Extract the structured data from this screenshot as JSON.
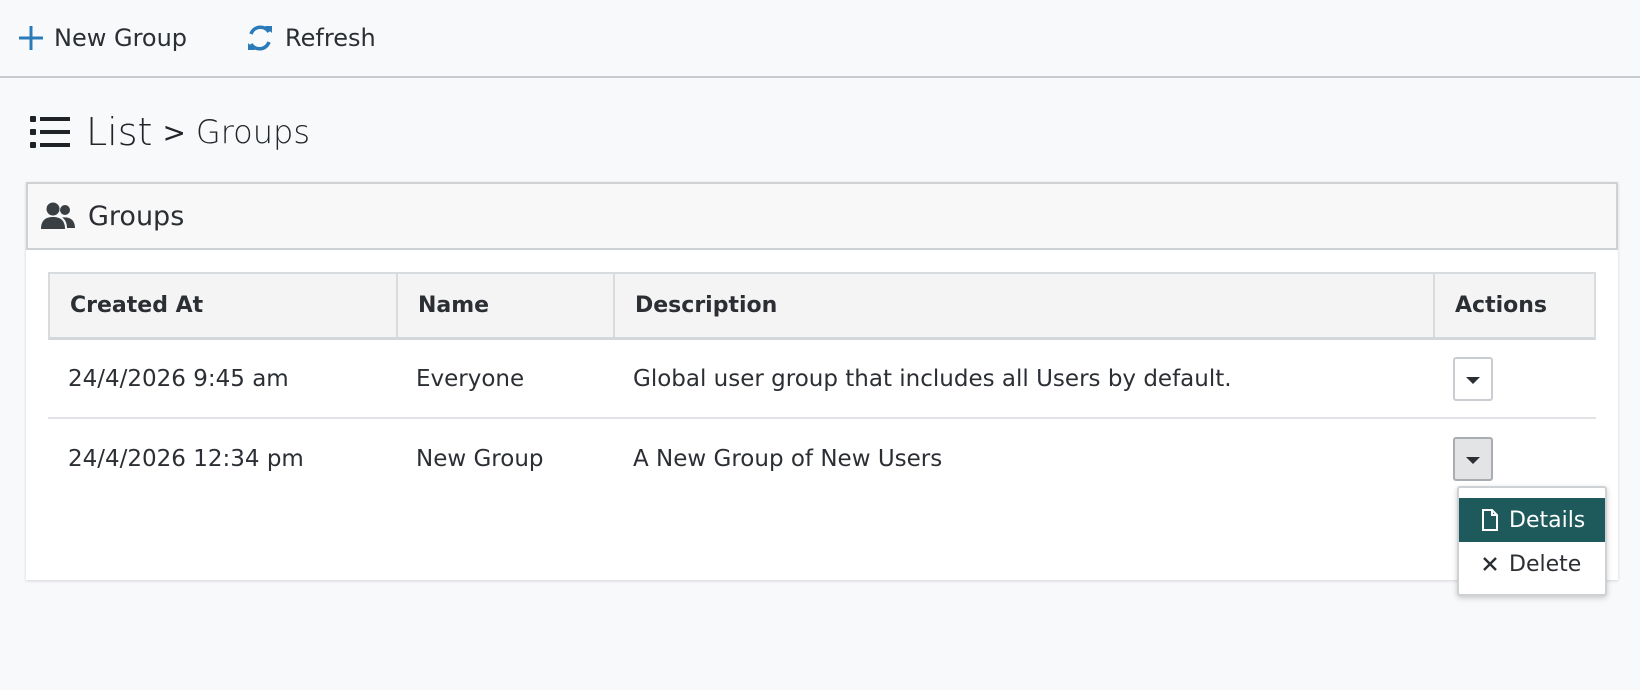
{
  "toolbar": {
    "new_group_label": "New Group",
    "refresh_label": "Refresh"
  },
  "page": {
    "title": "List",
    "separator": ">",
    "subtitle": "Groups"
  },
  "card": {
    "title": "Groups"
  },
  "table": {
    "headers": [
      "Created At",
      "Name",
      "Description",
      "Actions"
    ],
    "rows": [
      {
        "created_at": "24/4/2026 9:45 am",
        "name": "Everyone",
        "description": "Global user group that includes all Users by default."
      },
      {
        "created_at": "24/4/2026 12:34 pm",
        "name": "New Group",
        "description": "A New Group of New Users"
      }
    ]
  },
  "dropdown": {
    "items": [
      {
        "label": "Details",
        "icon": "file-icon"
      },
      {
        "label": "Delete",
        "icon": "close-icon"
      }
    ]
  },
  "colors": {
    "accent": "#1e5a5c",
    "icon_blue": "#2b7bb9"
  }
}
